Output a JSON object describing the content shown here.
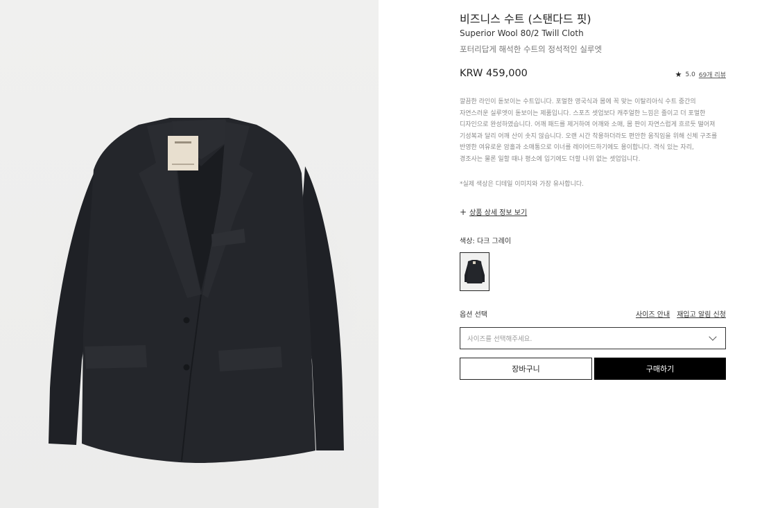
{
  "product": {
    "title": "비즈니스 수트 (스탠다드 핏)",
    "subtitle": "Superior Wool 80/2 Twill Cloth",
    "tagline": "포터리답게 해석한 수트의 정석적인 실루엣",
    "price": "KRW 459,000",
    "rating": {
      "score": "5.0",
      "reviews_label": "69개 리뷰",
      "star_icon": "star-icon"
    },
    "description_lines": [
      "깔끔한 라인이 돋보이는 수트입니다. 포멀한 영국식과 몸에 꼭 맞는 이탈리아식 수트 중간의",
      "자연스러운 실루엣이 돋보이는 제품입니다. 스포츠 셋업보다 캐주얼한 느낌은 줄이고 더 포멀한",
      "디자인으로 완성하였습니다. 어깨 패드를 제거하여 어깨와 소매, 몸 판이 자연스럽게 흐르듯 떨어져",
      "기성복과 달리 어깨 산이 솟지 않습니다. 오랜 시간 착용하더라도 편안한 움직임을 위해 신체 구조를",
      "반영한 여유로운 암홀과 소매통으로 이너를 레이어드하기에도 용이합니다. 격식 있는 자리,",
      "경조사는 물론 일할 때나 평소에 입기에도 더할 나위 없는 셋업입니다."
    ],
    "note": "*실제 색상은 디테일 이미지와 가장 유사합니다.",
    "detail_link": "상품 상세 정보 보기",
    "color_label": "색상: 다크 그레이",
    "option_label": "옵션 선택",
    "size_guide": "사이즈 안내",
    "restock_alert": "재입고 알림 신청",
    "size_select_placeholder": "사이즈를 선택해주세요.",
    "cart_button": "장바구니",
    "buy_button": "구매하기"
  },
  "colors": {
    "jacket": "#24262b",
    "background": "#eeeeed",
    "buy_button_bg": "#000000"
  }
}
